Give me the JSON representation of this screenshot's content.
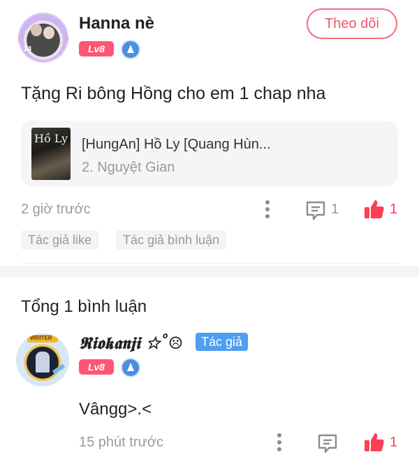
{
  "post": {
    "author": {
      "name": "Hanna nè",
      "level": "Lv8"
    },
    "follow_label": "Theo dõi",
    "content": "Tặng Ri bông Hồng cho em 1 chap nha",
    "book": {
      "title": "[HungAn] Hồ Ly [Quang Hùn...",
      "chapter": "2. Nguyệt Gian",
      "cover_text": "Hồ Ly"
    },
    "time": "2 giờ trước",
    "comment_count": "1",
    "like_count": "1",
    "tags": [
      "Tác giả like",
      "Tác giả bình luận"
    ]
  },
  "comments_section": {
    "total_label": "Tổng 1 bình luận",
    "comments": [
      {
        "name": "𝕽𝖎𝖔𝖐𝖆𝖓𝖏𝖎 ☆˚☹",
        "badge": "Tác giả",
        "level": "Lv8",
        "avatar_ribbon": "WRITER",
        "text": "Vângg>.<",
        "time": "15 phút trước",
        "comment_count": "",
        "like_count": "1"
      }
    ]
  },
  "colors": {
    "accent": "#ff3d55",
    "follow_border": "#f26b80",
    "level_badge": "#ff5574",
    "author_badge": "#4e9ef2",
    "muted_text": "#9b9b9b"
  },
  "icons": [
    "medal-icon",
    "more-dots-icon",
    "comment-icon",
    "like-icon"
  ]
}
